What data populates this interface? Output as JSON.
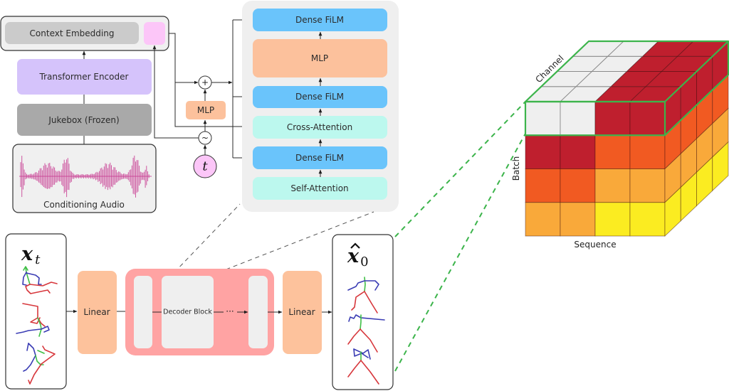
{
  "context_embedding": {
    "label": "Context Embedding"
  },
  "conditioning": {
    "transformer_label": "Transformer Encoder",
    "jukebox_label": "Jukebox (Frozen)",
    "audio_label": "Conditioning Audio"
  },
  "timestep": {
    "symbol": "t",
    "add_symbol": "+",
    "sinusoidal_symbol": "~",
    "mlp_label": "MLP"
  },
  "decoder_detail": {
    "layers": [
      {
        "label": "Dense FiLM",
        "kind": "dense_film"
      },
      {
        "label": "MLP",
        "kind": "mlp"
      },
      {
        "label": "Dense FiLM",
        "kind": "dense_film"
      },
      {
        "label": "Cross-Attention",
        "kind": "attention"
      },
      {
        "label": "Dense FiLM",
        "kind": "dense_film"
      },
      {
        "label": "Self-Attention",
        "kind": "attention"
      }
    ]
  },
  "pipeline": {
    "input_symbol": "x",
    "input_subscript": "t",
    "linear_in_label": "Linear",
    "decoder_block_label": "Decoder Block",
    "ellipsis": "···",
    "linear_out_label": "Linear",
    "output_symbol": "x",
    "output_subscript": "0"
  },
  "tensor": {
    "channel_label": "Channel",
    "batch_label": "Batch",
    "sequence_label": "Sequence",
    "front_grid": [
      [
        "#efefef",
        "#efefef",
        "#bf1f2e",
        "#bf1f2e"
      ],
      [
        "#bf1f2e",
        "#bf1f2e",
        "#f15a22",
        "#f15a22"
      ],
      [
        "#f15a22",
        "#f15a22",
        "#f9a93a",
        "#f9a93a"
      ],
      [
        "#f9a93a",
        "#f9a93a",
        "#fbec21",
        "#fbec21"
      ]
    ],
    "depth_cells": 4,
    "highlight_color": "#3cb44b"
  },
  "colors": {
    "context_outer": "#f0f0f0",
    "context_inner": "#cbcbcb",
    "pink": "#fcc6f8",
    "transformer": "#d5c3fb",
    "jukebox": "#a9a9a9",
    "panel_bg": "#efefef",
    "dense_film": "#6ac4fb",
    "mlp": "#fcc19c",
    "attention": "#bcf8ee",
    "linear": "#fdc29c",
    "decoder_outer": "#ffa3a3",
    "decoder_inner": "#efefef",
    "waveform": "#c83c91",
    "skeleton_red": "#d7373c",
    "skeleton_blue": "#3a3cb4",
    "skeleton_green": "#3fbf46"
  }
}
